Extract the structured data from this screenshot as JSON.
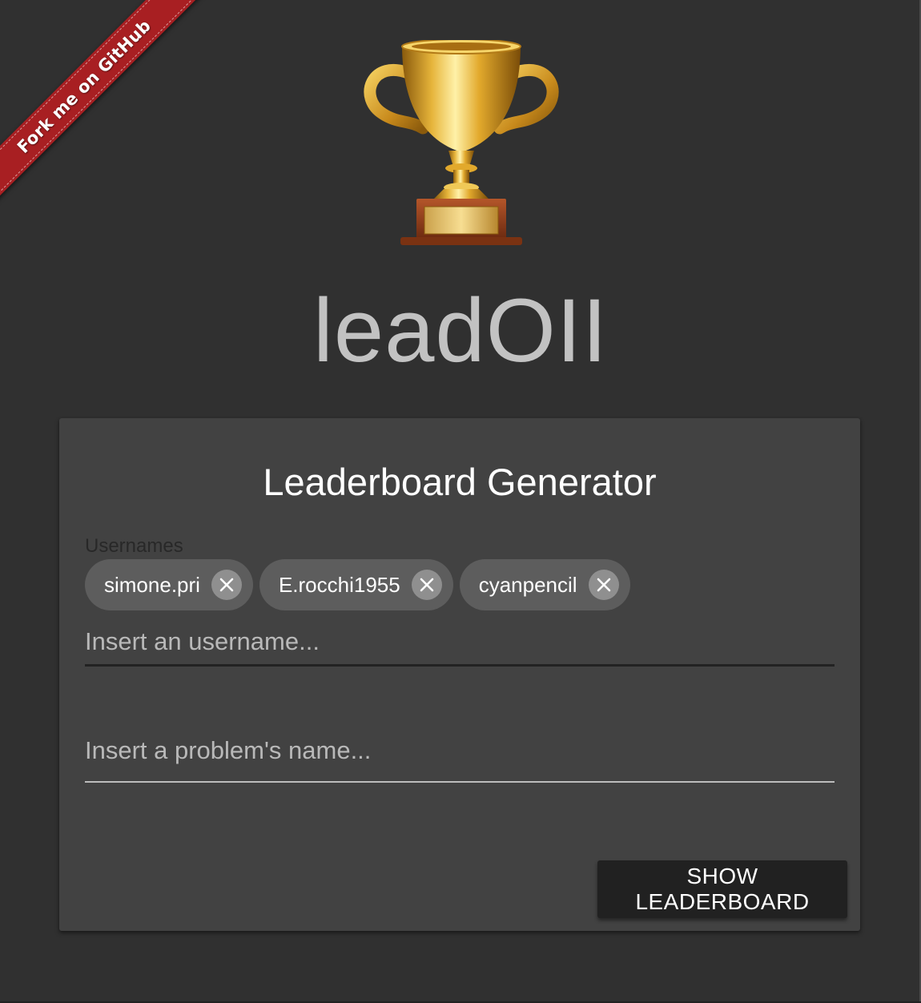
{
  "ribbon": {
    "text": "Fork me on GitHub",
    "color": "#a81f22"
  },
  "header": {
    "logo_icon": "trophy-icon",
    "app_title": "leadOII"
  },
  "form": {
    "title": "Leaderboard Generator",
    "usernames_label": "Usernames",
    "chips": [
      {
        "label": "simone.pri"
      },
      {
        "label": "E.rocchi1955"
      },
      {
        "label": "cyanpencil"
      }
    ],
    "chip_remove_icon": "close-icon",
    "username_placeholder": "Insert an username...",
    "username_value": "",
    "problem_placeholder": "Insert a problem's name...",
    "problem_value": "",
    "submit_label": "SHOW LEADERBOARD"
  },
  "colors": {
    "background": "#303030",
    "card": "#424242",
    "chip": "#5d5d5d",
    "button": "#212121"
  }
}
